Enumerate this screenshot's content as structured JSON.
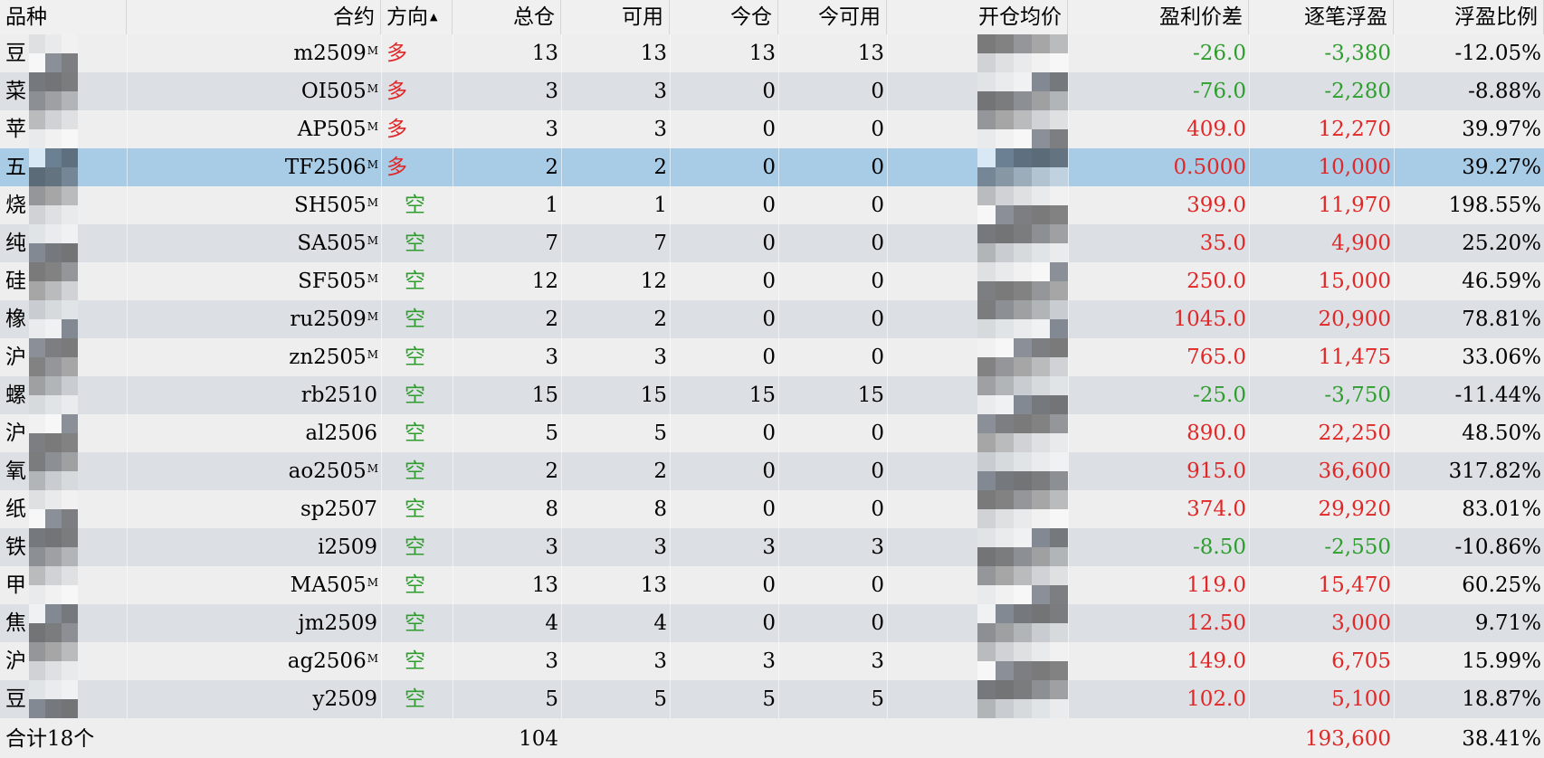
{
  "colors": {
    "profit": "#e02828",
    "loss": "#2f9e2f",
    "long": "#e02828",
    "short": "#2f9e2f",
    "row_odd": "#eeeeee",
    "row_even": "#dcdfe3",
    "row_selected": "#a8cce6"
  },
  "columns": {
    "variety": "品种",
    "contract": "合约",
    "direction": "方向",
    "total": "总仓",
    "available": "可用",
    "today": "今仓",
    "today_available": "今可用",
    "avg_open_price": "开仓均价",
    "profit_price_diff": "盈利价差",
    "float_pnl": "逐笔浮盈",
    "float_pnl_ratio": "浮盈比例"
  },
  "sort": {
    "column": "direction",
    "icon": "sort-ascending-icon",
    "glyph": "▲"
  },
  "rows": [
    {
      "variety": "豆",
      "contract": "m2509",
      "main_mark": "M",
      "direction": "多",
      "dir_type": "long",
      "total": "13",
      "available": "13",
      "today": "13",
      "today_available": "13",
      "profit_price_diff": "-26.0",
      "float_pnl": "-3,380",
      "float_pnl_ratio": "-12.05%",
      "pnl_sign": "loss",
      "selected": false
    },
    {
      "variety": "菜",
      "contract": "OI505",
      "main_mark": "M",
      "direction": "多",
      "dir_type": "long",
      "total": "3",
      "available": "3",
      "today": "0",
      "today_available": "0",
      "profit_price_diff": "-76.0",
      "float_pnl": "-2,280",
      "float_pnl_ratio": "-8.88%",
      "pnl_sign": "loss",
      "selected": false
    },
    {
      "variety": "苹",
      "contract": "AP505",
      "main_mark": "M",
      "direction": "多",
      "dir_type": "long",
      "total": "3",
      "available": "3",
      "today": "0",
      "today_available": "0",
      "profit_price_diff": "409.0",
      "float_pnl": "12,270",
      "float_pnl_ratio": "39.97%",
      "pnl_sign": "profit",
      "selected": false
    },
    {
      "variety": "五",
      "contract": "TF2506",
      "main_mark": "M",
      "direction": "多",
      "dir_type": "long",
      "total": "2",
      "available": "2",
      "today": "0",
      "today_available": "0",
      "profit_price_diff": "0.5000",
      "float_pnl": "10,000",
      "float_pnl_ratio": "39.27%",
      "pnl_sign": "profit",
      "selected": true
    },
    {
      "variety": "烧",
      "contract": "SH505",
      "main_mark": "M",
      "direction": "空",
      "dir_type": "short",
      "total": "1",
      "available": "1",
      "today": "0",
      "today_available": "0",
      "profit_price_diff": "399.0",
      "float_pnl": "11,970",
      "float_pnl_ratio": "198.55%",
      "pnl_sign": "profit",
      "selected": false
    },
    {
      "variety": "纯",
      "contract": "SA505",
      "main_mark": "M",
      "direction": "空",
      "dir_type": "short",
      "total": "7",
      "available": "7",
      "today": "0",
      "today_available": "0",
      "profit_price_diff": "35.0",
      "float_pnl": "4,900",
      "float_pnl_ratio": "25.20%",
      "pnl_sign": "profit",
      "selected": false
    },
    {
      "variety": "硅",
      "contract": "SF505",
      "main_mark": "M",
      "direction": "空",
      "dir_type": "short",
      "total": "12",
      "available": "12",
      "today": "0",
      "today_available": "0",
      "profit_price_diff": "250.0",
      "float_pnl": "15,000",
      "float_pnl_ratio": "46.59%",
      "pnl_sign": "profit",
      "selected": false
    },
    {
      "variety": "橡",
      "contract": "ru2509",
      "main_mark": "M",
      "direction": "空",
      "dir_type": "short",
      "total": "2",
      "available": "2",
      "today": "0",
      "today_available": "0",
      "profit_price_diff": "1045.0",
      "float_pnl": "20,900",
      "float_pnl_ratio": "78.81%",
      "pnl_sign": "profit",
      "selected": false
    },
    {
      "variety": "沪",
      "contract": "zn2505",
      "main_mark": "M",
      "direction": "空",
      "dir_type": "short",
      "total": "3",
      "available": "3",
      "today": "0",
      "today_available": "0",
      "profit_price_diff": "765.0",
      "float_pnl": "11,475",
      "float_pnl_ratio": "33.06%",
      "pnl_sign": "profit",
      "selected": false
    },
    {
      "variety": "螺",
      "contract": "rb2510",
      "main_mark": "",
      "direction": "空",
      "dir_type": "short",
      "total": "15",
      "available": "15",
      "today": "15",
      "today_available": "15",
      "profit_price_diff": "-25.0",
      "float_pnl": "-3,750",
      "float_pnl_ratio": "-11.44%",
      "pnl_sign": "loss",
      "selected": false
    },
    {
      "variety": "沪",
      "contract": "al2506",
      "main_mark": "",
      "direction": "空",
      "dir_type": "short",
      "total": "5",
      "available": "5",
      "today": "0",
      "today_available": "0",
      "profit_price_diff": "890.0",
      "float_pnl": "22,250",
      "float_pnl_ratio": "48.50%",
      "pnl_sign": "profit",
      "selected": false
    },
    {
      "variety": "氧",
      "contract": "ao2505",
      "main_mark": "M",
      "direction": "空",
      "dir_type": "short",
      "total": "2",
      "available": "2",
      "today": "0",
      "today_available": "0",
      "profit_price_diff": "915.0",
      "float_pnl": "36,600",
      "float_pnl_ratio": "317.82%",
      "pnl_sign": "profit",
      "selected": false
    },
    {
      "variety": "纸",
      "contract": "sp2507",
      "main_mark": "",
      "direction": "空",
      "dir_type": "short",
      "total": "8",
      "available": "8",
      "today": "0",
      "today_available": "0",
      "profit_price_diff": "374.0",
      "float_pnl": "29,920",
      "float_pnl_ratio": "83.01%",
      "pnl_sign": "profit",
      "selected": false
    },
    {
      "variety": "铁",
      "contract": "i2509",
      "main_mark": "",
      "direction": "空",
      "dir_type": "short",
      "total": "3",
      "available": "3",
      "today": "3",
      "today_available": "3",
      "profit_price_diff": "-8.50",
      "float_pnl": "-2,550",
      "float_pnl_ratio": "-10.86%",
      "pnl_sign": "loss",
      "selected": false
    },
    {
      "variety": "甲",
      "contract": "MA505",
      "main_mark": "M",
      "direction": "空",
      "dir_type": "short",
      "total": "13",
      "available": "13",
      "today": "0",
      "today_available": "0",
      "profit_price_diff": "119.0",
      "float_pnl": "15,470",
      "float_pnl_ratio": "60.25%",
      "pnl_sign": "profit",
      "selected": false
    },
    {
      "variety": "焦",
      "contract": "jm2509",
      "main_mark": "",
      "direction": "空",
      "dir_type": "short",
      "total": "4",
      "available": "4",
      "today": "0",
      "today_available": "0",
      "profit_price_diff": "12.50",
      "float_pnl": "3,000",
      "float_pnl_ratio": "9.71%",
      "pnl_sign": "profit",
      "selected": false
    },
    {
      "variety": "沪",
      "contract": "ag2506",
      "main_mark": "M",
      "direction": "空",
      "dir_type": "short",
      "total": "3",
      "available": "3",
      "today": "3",
      "today_available": "3",
      "profit_price_diff": "149.0",
      "float_pnl": "6,705",
      "float_pnl_ratio": "15.99%",
      "pnl_sign": "profit",
      "selected": false
    },
    {
      "variety": "豆",
      "contract": "y2509",
      "main_mark": "",
      "direction": "空",
      "dir_type": "short",
      "total": "5",
      "available": "5",
      "today": "5",
      "today_available": "5",
      "profit_price_diff": "102.0",
      "float_pnl": "5,100",
      "float_pnl_ratio": "18.87%",
      "pnl_sign": "profit",
      "selected": false
    }
  ],
  "footer": {
    "label": "合计18个",
    "total": "104",
    "float_pnl": "193,600",
    "float_pnl_ratio": "38.41%"
  }
}
